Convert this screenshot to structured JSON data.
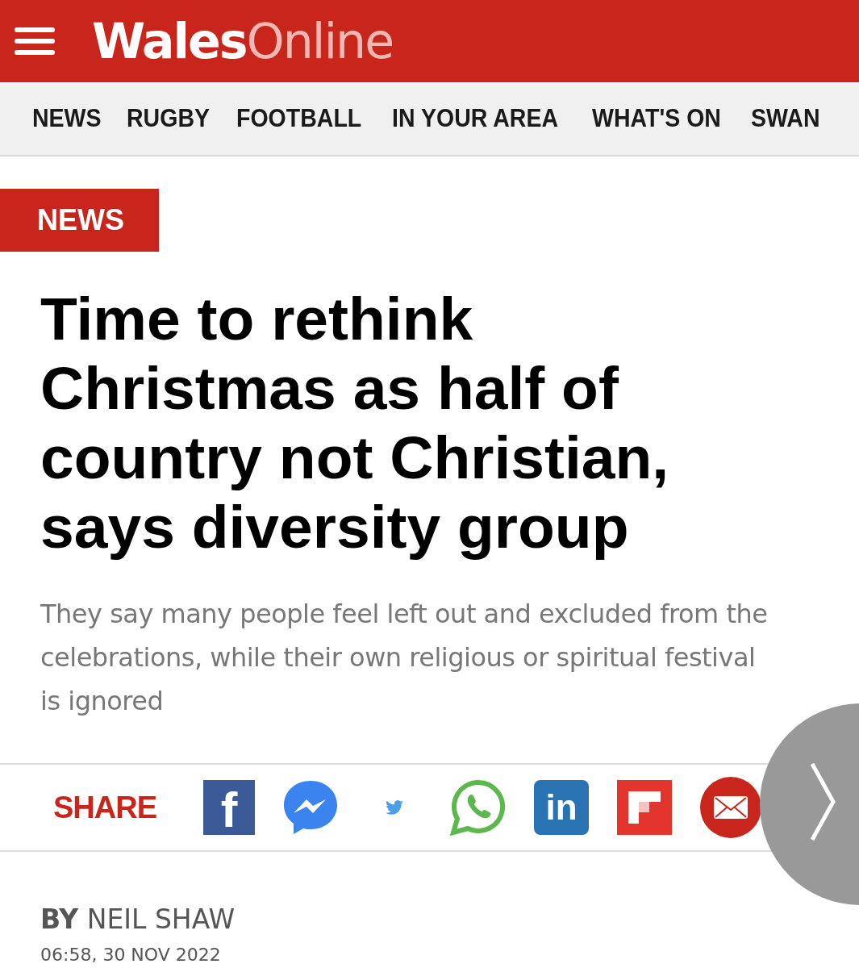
{
  "header": {
    "logo": "**Wales**Online"
  },
  "nav": {
    "items": [
      {
        "label": "NEWS"
      },
      {
        "label": "RUGBY"
      },
      {
        "label": "FOOTBALL"
      },
      {
        "label": "IN YOUR AREA"
      },
      {
        "label": "WHAT'S ON"
      },
      {
        "label": "SWAN"
      }
    ]
  },
  "section_tag": "NEWS",
  "headline": "Time to rethink Christmas as half of country not Christian, says diversity group",
  "standfirst": "They say many people feel left out and excluded from the celebrations, while their own religious or spiritual festival is ignored",
  "share": {
    "label": "SHARE",
    "buttons": [
      {
        "kind": "facebook",
        "glyph": "f"
      },
      {
        "kind": "messenger"
      },
      {
        "kind": "twitter"
      },
      {
        "kind": "whatsapp"
      },
      {
        "kind": "linkedin",
        "glyph": "in"
      },
      {
        "kind": "flipboard"
      },
      {
        "kind": "email"
      }
    ]
  },
  "byline": "**BY** NEIL SHAW",
  "date": "06:58, 30 NOV 2022"
}
